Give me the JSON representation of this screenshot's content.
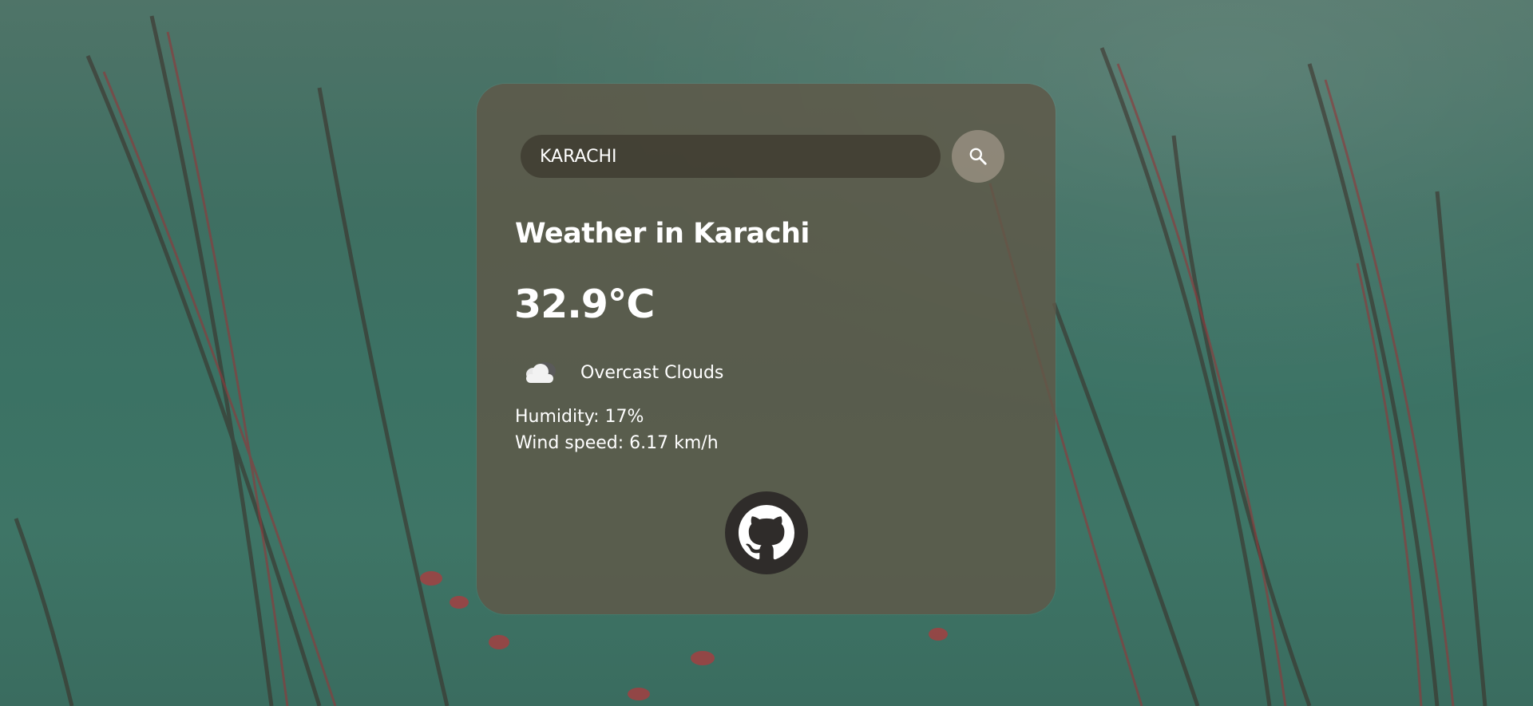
{
  "search": {
    "value": "KARACHI",
    "icon": "search-icon"
  },
  "weather": {
    "title": "Weather in Karachi",
    "temperature": "32.9°C",
    "description": "Overcast Clouds",
    "description_icon": "cloud-icon",
    "humidity": "Humidity: 17%",
    "wind": "Wind speed: 6.17 km/h"
  },
  "footer": {
    "link_icon": "github-icon"
  },
  "colors": {
    "card_background": "#5f5848",
    "text": "#ffffff",
    "github_button": "#2f2c2a"
  }
}
